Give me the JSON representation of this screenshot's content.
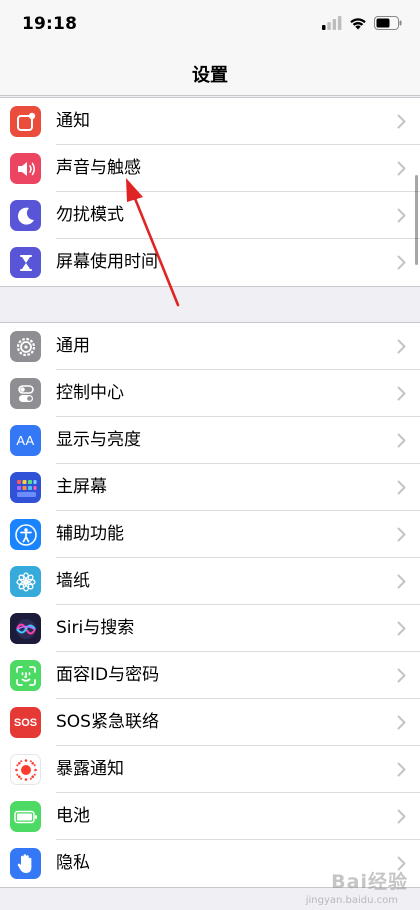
{
  "status_bar": {
    "time": "19:18"
  },
  "nav": {
    "title": "设置"
  },
  "group1": [
    {
      "label": "通知",
      "icon": "notification-icon",
      "color": "#eb4d3d"
    },
    {
      "label": "声音与触感",
      "icon": "speaker-icon",
      "color": "#eb4561"
    },
    {
      "label": "勿扰模式",
      "icon": "moon-icon",
      "color": "#5856d6"
    },
    {
      "label": "屏幕使用时间",
      "icon": "hourglass-icon",
      "color": "#5856d6"
    }
  ],
  "group2": [
    {
      "label": "通用",
      "icon": "gear-icon",
      "color": "#8e8e93"
    },
    {
      "label": "控制中心",
      "icon": "toggles-icon",
      "color": "#8e8e93"
    },
    {
      "label": "显示与亮度",
      "icon": "text-size-icon",
      "color": "#3478f6"
    },
    {
      "label": "主屏幕",
      "icon": "home-grid-icon",
      "color": "#2f52d6"
    },
    {
      "label": "辅助功能",
      "icon": "accessibility-icon",
      "color": "#1a84ff"
    },
    {
      "label": "墙纸",
      "icon": "flower-icon",
      "color": "#37aadc"
    },
    {
      "label": "Siri与搜索",
      "icon": "siri-icon",
      "color": "#1c1c3a"
    },
    {
      "label": "面容ID与密码",
      "icon": "face-id-icon",
      "color": "#4cd964"
    },
    {
      "label": "SOS紧急联络",
      "icon": "sos-icon",
      "color": "#e53935"
    },
    {
      "label": "暴露通知",
      "icon": "exposure-icon",
      "color": "#ffffff"
    },
    {
      "label": "电池",
      "icon": "battery-icon",
      "color": "#4cd964"
    },
    {
      "label": "隐私",
      "icon": "hand-icon",
      "color": "#3478f6"
    }
  ],
  "sos_text": "SOS",
  "text_size_text": "AA",
  "watermark": {
    "main": "Bai经验",
    "sub": "jingyan.baidu.com"
  }
}
